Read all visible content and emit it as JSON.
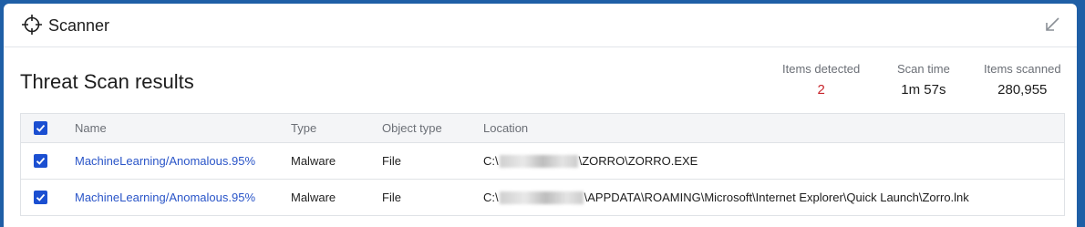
{
  "window": {
    "title": "Scanner"
  },
  "heading": "Threat Scan results",
  "stats": {
    "detected": {
      "label": "Items detected",
      "value": "2"
    },
    "scan_time": {
      "label": "Scan time",
      "value": "1m 57s"
    },
    "scanned": {
      "label": "Items scanned",
      "value": "280,955"
    }
  },
  "table": {
    "columns": {
      "name": "Name",
      "type": "Type",
      "object_type": "Object type",
      "location": "Location"
    },
    "rows": [
      {
        "name": "MachineLearning/Anomalous.95%",
        "type": "Malware",
        "object_type": "File",
        "location_prefix": "C:\\",
        "location_suffix": "\\ZORRO\\ZORRO.EXE"
      },
      {
        "name": "MachineLearning/Anomalous.95%",
        "type": "Malware",
        "object_type": "File",
        "location_prefix": "C:\\",
        "location_suffix": "\\APPDATA\\ROAMING\\Microsoft\\Internet Explorer\\Quick Launch\\Zorro.lnk"
      }
    ]
  },
  "colors": {
    "accent": "#1b4fd1",
    "link": "#2a55c8",
    "alert": "#c8262d",
    "background": "#1f5fa6"
  }
}
